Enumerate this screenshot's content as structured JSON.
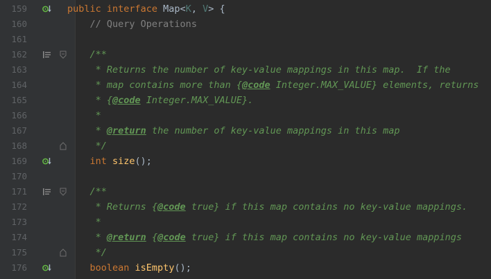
{
  "lines": [
    {
      "num": "159",
      "impl": true,
      "fold": false,
      "doc": false,
      "indent": "",
      "tokens": [
        [
          "kw",
          "public interface "
        ],
        [
          "n",
          "Map<"
        ],
        [
          "tp",
          "K"
        ],
        [
          "n",
          ", "
        ],
        [
          "tp",
          "V"
        ],
        [
          "n",
          "> {"
        ]
      ]
    },
    {
      "num": "160",
      "indent": "    ",
      "tokens": [
        [
          "cm",
          "// Query Operations"
        ]
      ]
    },
    {
      "num": "161",
      "indent": "",
      "tokens": []
    },
    {
      "num": "162",
      "doc": true,
      "fold": "open",
      "indent": "    ",
      "tokens": [
        [
          "dc",
          "/**"
        ]
      ]
    },
    {
      "num": "163",
      "indent": "     ",
      "tokens": [
        [
          "dc",
          "* Returns the number of key-value mappings in this map.  If the"
        ]
      ]
    },
    {
      "num": "164",
      "indent": "     ",
      "tokens": [
        [
          "dc",
          "* map contains more than {"
        ],
        [
          "tag",
          "@code"
        ],
        [
          "dc",
          " Integer.MAX_VALUE} elements, returns"
        ]
      ]
    },
    {
      "num": "165",
      "indent": "     ",
      "tokens": [
        [
          "dc",
          "* {"
        ],
        [
          "tag",
          "@code"
        ],
        [
          "dc",
          " Integer.MAX_VALUE}."
        ]
      ]
    },
    {
      "num": "166",
      "indent": "     ",
      "tokens": [
        [
          "dc",
          "*"
        ]
      ]
    },
    {
      "num": "167",
      "indent": "     ",
      "tokens": [
        [
          "dc",
          "* "
        ],
        [
          "tag",
          "@return"
        ],
        [
          "dc",
          " the number of key-value mappings in this map"
        ]
      ]
    },
    {
      "num": "168",
      "fold": "close",
      "indent": "     ",
      "tokens": [
        [
          "dc",
          "*/"
        ]
      ]
    },
    {
      "num": "169",
      "impl": true,
      "indent": "    ",
      "tokens": [
        [
          "kw",
          "int "
        ],
        [
          "fn",
          "size"
        ],
        [
          "n",
          "();"
        ]
      ]
    },
    {
      "num": "170",
      "indent": "",
      "tokens": []
    },
    {
      "num": "171",
      "doc": true,
      "fold": "open",
      "indent": "    ",
      "tokens": [
        [
          "dc",
          "/**"
        ]
      ]
    },
    {
      "num": "172",
      "indent": "     ",
      "tokens": [
        [
          "dc",
          "* Returns {"
        ],
        [
          "tag",
          "@code"
        ],
        [
          "dc",
          " true} if this map contains no key-value mappings."
        ]
      ]
    },
    {
      "num": "173",
      "indent": "     ",
      "tokens": [
        [
          "dc",
          "*"
        ]
      ]
    },
    {
      "num": "174",
      "indent": "     ",
      "tokens": [
        [
          "dc",
          "* "
        ],
        [
          "tag",
          "@return"
        ],
        [
          "dc",
          " {"
        ],
        [
          "tag",
          "@code"
        ],
        [
          "dc",
          " true} if this map contains no key-value mappings"
        ]
      ]
    },
    {
      "num": "175",
      "fold": "close",
      "indent": "     ",
      "tokens": [
        [
          "dc",
          "*/"
        ]
      ]
    },
    {
      "num": "176",
      "impl": true,
      "indent": "    ",
      "tokens": [
        [
          "kw",
          "boolean "
        ],
        [
          "fn",
          "isEmpty"
        ],
        [
          "n",
          "();"
        ]
      ]
    }
  ],
  "colors": {
    "background": "#2b2b2b",
    "keyword": "#cc7832",
    "doc": "#629755",
    "comment": "#808080",
    "method": "#ffc66d",
    "type_param": "#507874"
  },
  "icons": {
    "implemented": "implemented-method-icon",
    "doc": "rendered-doc-icon",
    "fold": "fold-toggle-icon"
  }
}
